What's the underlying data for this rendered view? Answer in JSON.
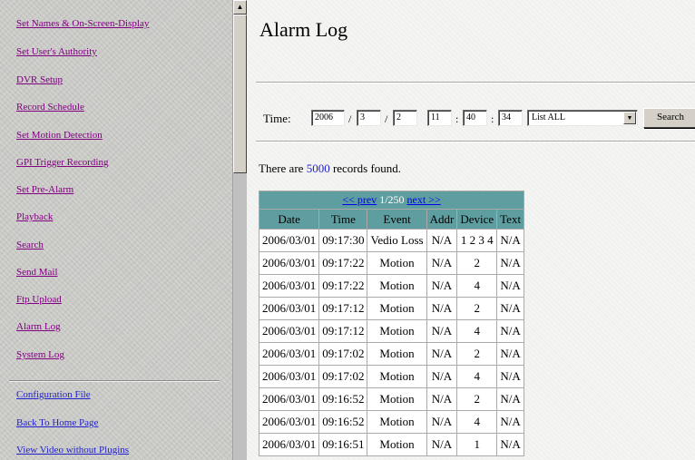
{
  "nav": {
    "items": [
      {
        "label": "Set Names & On-Screen-Display",
        "link_color": "purple"
      },
      {
        "label": "Set User's Authority",
        "link_color": "purple"
      },
      {
        "label": "DVR Setup",
        "link_color": "purple"
      },
      {
        "label": "Record Schedule",
        "link_color": "purple"
      },
      {
        "label": "Set Motion Detection",
        "link_color": "purple"
      },
      {
        "label": "GPI Trigger Recording",
        "link_color": "purple"
      },
      {
        "label": "Set Pre-Alarm",
        "link_color": "purple"
      },
      {
        "label": "Playback",
        "link_color": "purple"
      },
      {
        "label": "Search",
        "link_color": "purple"
      },
      {
        "label": "Send Mail",
        "link_color": "purple"
      },
      {
        "label": "Ftp Upload",
        "link_color": "purple"
      },
      {
        "label": "Alarm Log",
        "link_color": "purple"
      },
      {
        "label": "System Log",
        "link_color": "purple"
      }
    ],
    "bottom_items": [
      {
        "label": "Configuration File",
        "link_color": "blue"
      },
      {
        "label": "Back To Home Page",
        "link_color": "blue"
      },
      {
        "label": "View Video without Plugins",
        "link_color": "blue"
      }
    ]
  },
  "scrollbar": {
    "up_arrow_icon": "triangle-up-icon"
  },
  "page": {
    "title": "Alarm Log"
  },
  "filter": {
    "label": "Time:",
    "year": "2006",
    "sep1": "/",
    "month": "3",
    "sep2": "/",
    "day": "2",
    "hour": "11",
    "sep3": ":",
    "minute": "40",
    "sep4": ":",
    "second": "34",
    "list_mode": "List ALL",
    "dropdown_icon": "chevron-down-icon",
    "search_label": "Search"
  },
  "records": {
    "prefix": "There are",
    "count": "5000",
    "suffix": "records found."
  },
  "table": {
    "pager": {
      "prev": "<< prev",
      "page": "1/250",
      "next": "next >>"
    },
    "columns": [
      "Date",
      "Time",
      "Event",
      "Addr",
      "Device",
      "Text"
    ],
    "rows": [
      [
        "2006/03/01",
        "09:17:30",
        "Vedio Loss",
        "N/A",
        "1 2 3 4",
        "N/A"
      ],
      [
        "2006/03/01",
        "09:17:22",
        "Motion",
        "N/A",
        "2",
        "N/A"
      ],
      [
        "2006/03/01",
        "09:17:22",
        "Motion",
        "N/A",
        "4",
        "N/A"
      ],
      [
        "2006/03/01",
        "09:17:12",
        "Motion",
        "N/A",
        "2",
        "N/A"
      ],
      [
        "2006/03/01",
        "09:17:12",
        "Motion",
        "N/A",
        "4",
        "N/A"
      ],
      [
        "2006/03/01",
        "09:17:02",
        "Motion",
        "N/A",
        "2",
        "N/A"
      ],
      [
        "2006/03/01",
        "09:17:02",
        "Motion",
        "N/A",
        "4",
        "N/A"
      ],
      [
        "2006/03/01",
        "09:16:52",
        "Motion",
        "N/A",
        "2",
        "N/A"
      ],
      [
        "2006/03/01",
        "09:16:52",
        "Motion",
        "N/A",
        "4",
        "N/A"
      ],
      [
        "2006/03/01",
        "09:16:51",
        "Motion",
        "N/A",
        "1",
        "N/A"
      ]
    ]
  },
  "colors": {
    "table_header": "#5f9ea0",
    "visited_link": "#800080",
    "link": "#2222cc",
    "nav_background": "#c9c9c6"
  }
}
